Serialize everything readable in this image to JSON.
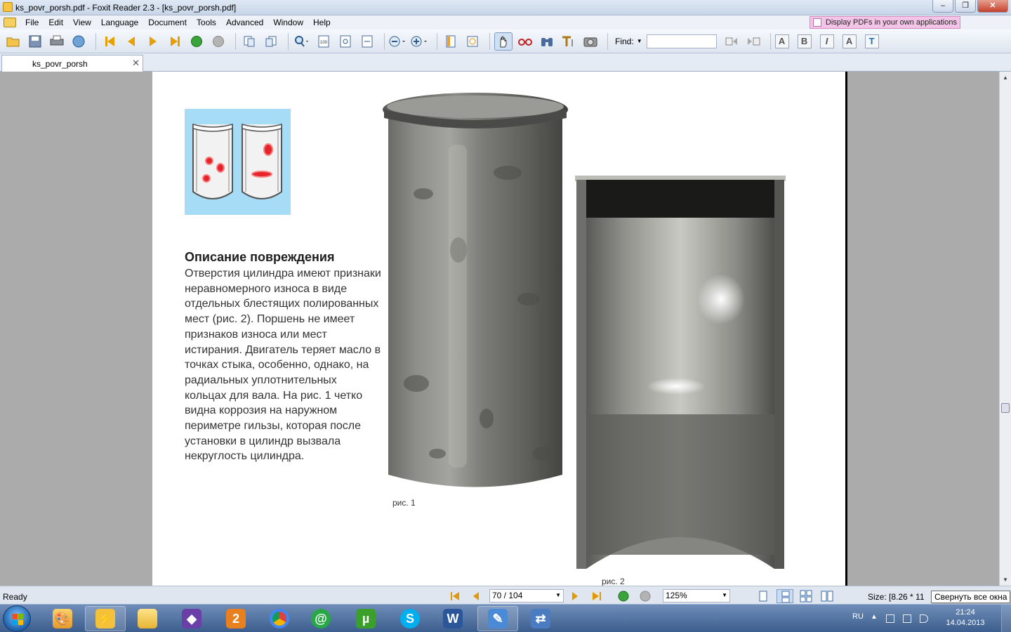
{
  "window": {
    "title": "ks_povr_porsh.pdf - Foxit Reader 2.3 - [ks_povr_porsh.pdf]",
    "controls": [
      "‒",
      "❐",
      "✕"
    ]
  },
  "menu": {
    "items": [
      "File",
      "Edit",
      "View",
      "Language",
      "Document",
      "Tools",
      "Advanced",
      "Window",
      "Help"
    ],
    "promo": "Display PDFs in your own applications"
  },
  "toolbar": {
    "find_label": "Find:",
    "find_value": ""
  },
  "tab": {
    "label": "ks_povr_porsh",
    "close": "✕"
  },
  "page": {
    "heading": "Описание повреждения",
    "body": "Отверстия цилиндра имеют признаки неравномерного износа в виде отдельных блестящих полированных мест (рис. 2). Поршень не имеет признаков износа или мест истирания. Двигатель теряет масло в точках стыка, особенно, однако, на радиальных уплотнительных кольцах для вала. На рис. 1 четко видна коррозия на наружном периметре гильзы, которая после установки в цилиндр вызвала некруглость цилиндра.",
    "caption1": "рис. 1",
    "caption2": "рис. 2"
  },
  "status": {
    "ready": "Ready",
    "page_indicator": "70 / 104",
    "zoom": "125%",
    "size": "Size: [8.26 * 11",
    "tooltip": "Свернуть все окна"
  },
  "tray": {
    "lang": "RU",
    "time": "21:24",
    "date": "14.04.2013"
  },
  "colors": {
    "diagram_bg": "#a6dcf5",
    "spot_red": "#e8222a",
    "page_bg": "#ffffff",
    "viewer_bg": "#ababab"
  }
}
